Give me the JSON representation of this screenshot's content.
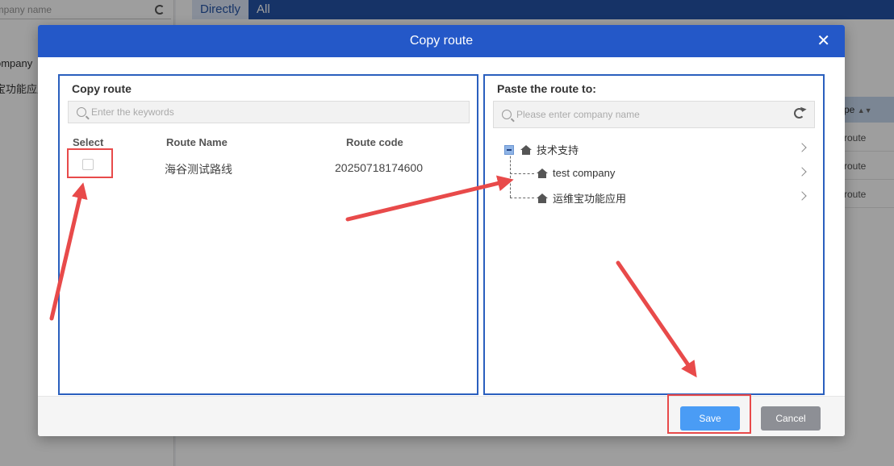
{
  "background": {
    "sidebar": {
      "search_placeholder": "ompany name",
      "items": [
        "ompany",
        "宝功能应用"
      ]
    },
    "tabs": [
      {
        "label": "Directly",
        "active": true
      },
      {
        "label": "All",
        "active": false
      }
    ],
    "table": {
      "type_header": "pe",
      "rows": [
        "route",
        "route",
        "route"
      ]
    }
  },
  "dialog": {
    "title": "Copy route",
    "left_panel": {
      "title": "Copy route",
      "search_placeholder": "Enter the keywords",
      "columns": [
        "Select",
        "Route Name",
        "Route code"
      ],
      "rows": [
        {
          "checked": false,
          "route_name": "海谷测试路线",
          "route_code": "20250718174600"
        }
      ]
    },
    "right_panel": {
      "title": "Paste the route to:",
      "search_placeholder": "Please enter company name",
      "tree": {
        "root": {
          "label": "技术支持",
          "expanded": true
        },
        "children": [
          {
            "label": "test company"
          },
          {
            "label": "运维宝功能应用"
          }
        ]
      }
    },
    "buttons": {
      "save": "Save",
      "cancel": "Cancel"
    }
  },
  "colors": {
    "header": "#2458c8",
    "panel_border": "#2a5fbe",
    "save_button": "#4a9cf5",
    "cancel_button": "#8d8f95",
    "annotation": "#e84a4a"
  }
}
